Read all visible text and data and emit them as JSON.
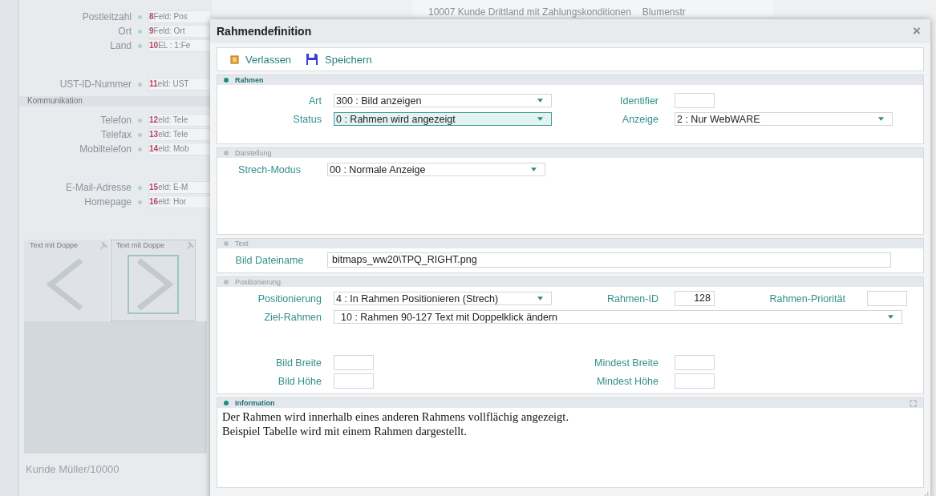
{
  "background": {
    "header_tabs": [
      "10007 Kunde Drittland mit Zahlungskonditionen",
      "Blumenstr"
    ],
    "field_groups": [
      {
        "fields": [
          {
            "label": "Postleitzahl",
            "number": "8",
            "value": "Feld: Pos"
          },
          {
            "label": "Ort",
            "number": "9",
            "value": "Feld: Ort"
          },
          {
            "label": "Land",
            "number": "10",
            "value": "EL : 1:Fe"
          },
          {
            "label": "UST-ID-Nummer",
            "number": "11",
            "value": "eld: UST"
          }
        ]
      },
      {
        "heading": "Kommunikation",
        "fields": [
          {
            "label": "Telefon",
            "number": "12",
            "value": "eld: Tele"
          },
          {
            "label": "Telefax",
            "number": "13",
            "value": "eld: Tele"
          },
          {
            "label": "Mobiltelefon",
            "number": "14",
            "value": "eld: Mob"
          },
          {
            "label": "E-Mail-Adresse",
            "number": "15",
            "value": "eld: E-M"
          },
          {
            "label": "Homepage",
            "number": "16",
            "value": "eld: Hor"
          }
        ]
      }
    ],
    "tiles": [
      {
        "label": "Text mit Doppe",
        "kind": "left",
        "selected": false
      },
      {
        "label": "Text mit Doppe",
        "kind": "right",
        "selected": true
      }
    ],
    "footer": "Kunde Müller/10000"
  },
  "dialog": {
    "title": "Rahmendefinition",
    "close": "×",
    "toolbar": [
      {
        "label": "Verlassen",
        "kind": "exit"
      },
      {
        "label": "Speichern",
        "kind": "save"
      }
    ],
    "sections": [
      {
        "title": "Rahmen",
        "kind": "grid",
        "highlighted": true,
        "rows": [
          [
            {
              "label": "Art",
              "kind": "select",
              "value": "300 : Bild anzeigen",
              "focused": false
            },
            {
              "label": "Identifier",
              "kind": "input-short"
            }
          ],
          [
            {
              "label": "Status",
              "kind": "select",
              "value": "0 : Rahmen wird angezeigt",
              "focused": true
            },
            {
              "label": "Anzeige",
              "kind": "select",
              "value": "2 : Nur WebWARE",
              "focused": false
            }
          ]
        ]
      },
      {
        "title": "Darstellung",
        "kind": "centered",
        "highlighted": false,
        "rows": [
          [
            {
              "label": "Strech-Modus",
              "kind": "select",
              "value": "00 : Normale Anzeige",
              "focused": false
            }
          ]
        ]
      },
      {
        "title": "Text",
        "kind": "centered",
        "highlighted": false,
        "rows": [
          [
            {
              "label": "Bild Dateiname",
              "kind": "input-long",
              "value": "bitmaps_ww20\\TPQ_RIGHT.png"
            }
          ]
        ]
      },
      {
        "title": "Positionierung",
        "kind": "grid",
        "highlighted": false,
        "rows": [
          [
            {
              "label": "Positionierung",
              "kind": "select",
              "value": "4 : In Rahmen Positionieren (Strech)",
              "focused": false
            },
            {
              "label": "Rahmen-ID",
              "kind": "input-short",
              "value": "128"
            },
            {
              "label": "Rahmen-Priorität",
              "kind": "input-short"
            }
          ],
          [
            {
              "label": "Ziel-Rahmen",
              "kind": "select-long",
              "value": "10 : Rahmen 90-127 Text mit Doppelklick ändern",
              "focused": false
            }
          ],
          [
            {
              "label": "Bild Breite",
              "kind": "input-short"
            },
            {
              "label": "Mindest Breite",
              "kind": "input-short"
            }
          ],
          [
            {
              "label": "Bild Höhe",
              "kind": "input-short"
            },
            {
              "label": "Mindest Höhe",
              "kind": "input-short"
            }
          ]
        ]
      },
      {
        "title": "Information",
        "kind": "info",
        "highlighted": true,
        "lines": [
          "Der Rahmen wird innerhalb eines anderen Rahmens vollflächig angezeigt.",
          "Beispiel Tabelle wird mit einem Rahmen dargestellt."
        ]
      }
    ]
  }
}
